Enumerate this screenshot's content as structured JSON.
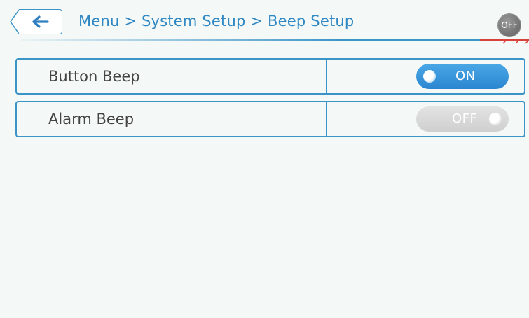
{
  "header": {
    "back_icon": "arrow-left-icon",
    "breadcrumb": "Menu > System Setup > Beep Setup",
    "status_badge": "OFF",
    "accent_color": "#3b94c8",
    "alert_color": "#d9413a"
  },
  "settings": [
    {
      "label": "Button Beep",
      "state": "ON",
      "enabled": true,
      "toggle_color": "#2f8fd8"
    },
    {
      "label": "Alarm Beep",
      "state": "OFF",
      "enabled": false,
      "toggle_color": "#d6d6d6"
    }
  ]
}
